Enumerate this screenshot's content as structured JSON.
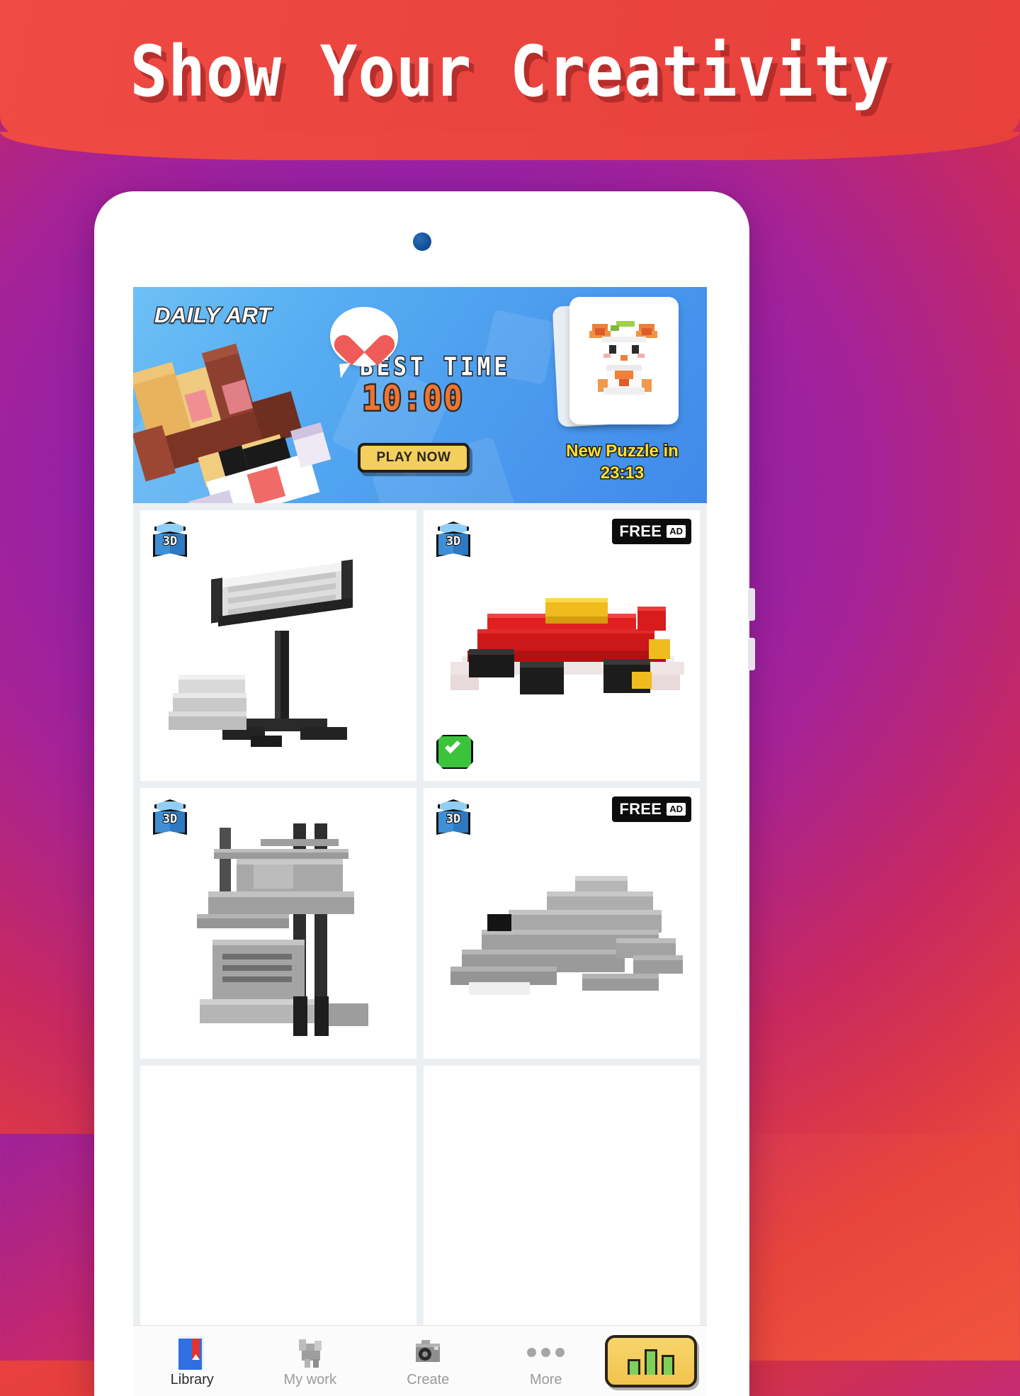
{
  "header": {
    "title": "Show Your Creativity"
  },
  "banner": {
    "label": "DAILY ART",
    "best_time_label": "BEST  TIME",
    "best_time_value": "10:00",
    "play_button": "PLAY NOW",
    "new_puzzle_label": "New Puzzle in",
    "new_puzzle_timer": "23:13",
    "heart_icon": "heart-icon",
    "accent_blue": "#4b9bee",
    "accent_yellow": "#f3cf5e",
    "timer_orange": "#ef7430",
    "timer_yellow": "#ffe02e"
  },
  "grid": {
    "badge_3d": "3D",
    "free_label": "FREE",
    "ad_label": "AD",
    "tiles": [
      {
        "name": "music-stand",
        "badge_3d": true,
        "free": false,
        "completed": false
      },
      {
        "name": "race-car",
        "badge_3d": true,
        "free": true,
        "completed": true
      },
      {
        "name": "forklift",
        "badge_3d": true,
        "free": false,
        "completed": false
      },
      {
        "name": "whale",
        "badge_3d": true,
        "free": true,
        "completed": false
      },
      {
        "name": "tile-5",
        "badge_3d": true,
        "free": false,
        "completed": false
      },
      {
        "name": "tile-6",
        "badge_3d": true,
        "free": false,
        "completed": false
      }
    ]
  },
  "bottom_nav": {
    "items": [
      {
        "label": "Library",
        "icon": "book-icon",
        "active": true
      },
      {
        "label": "My work",
        "icon": "voxel-icon",
        "active": false
      },
      {
        "label": "Create",
        "icon": "camera-icon",
        "active": false
      },
      {
        "label": "More",
        "icon": "dots-icon",
        "active": false
      }
    ],
    "fab_icon": "bar-chart-icon"
  }
}
